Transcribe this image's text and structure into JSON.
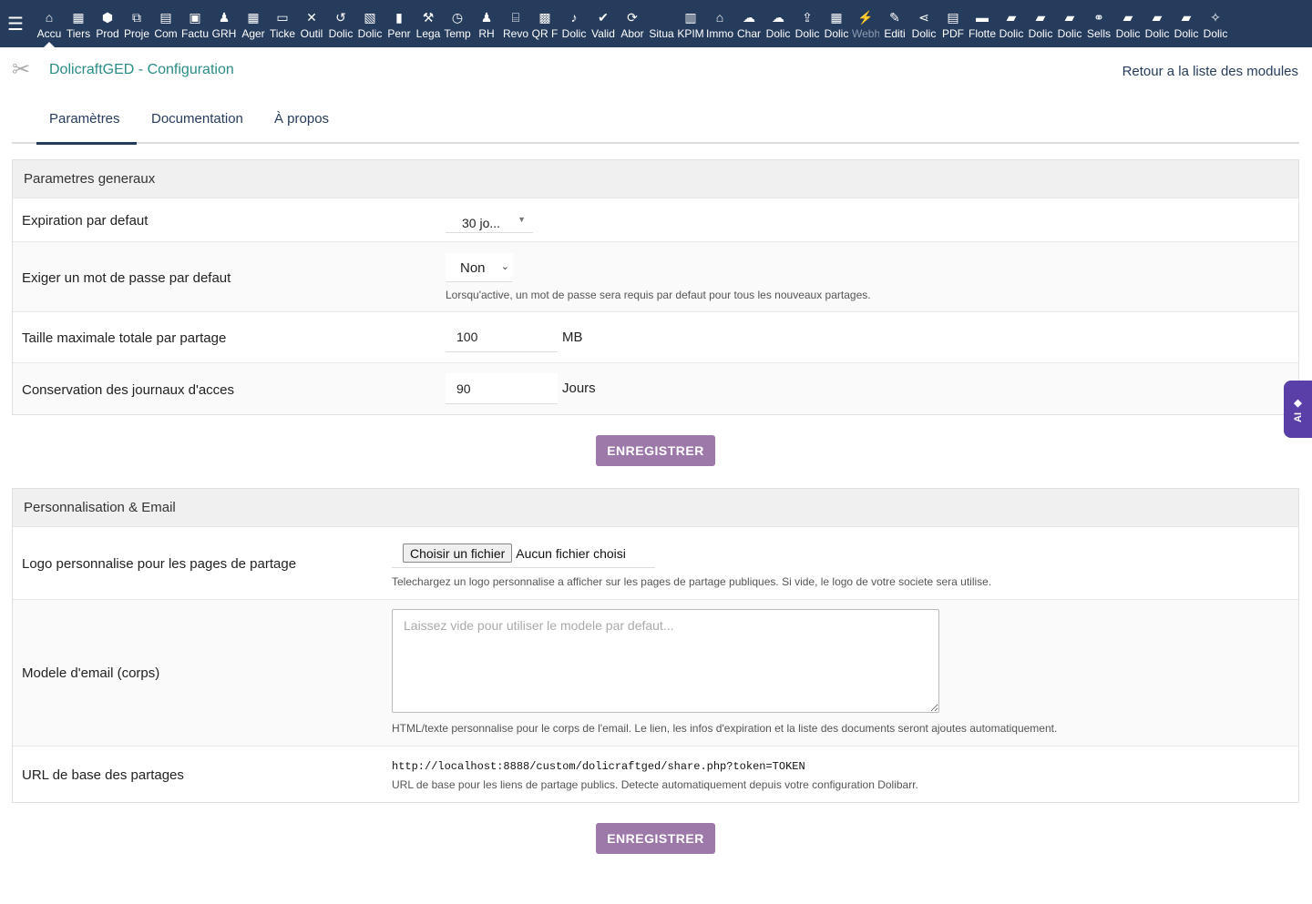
{
  "topbar": {
    "menu_icon": "hamburger-icon",
    "items": [
      {
        "label": "Accu",
        "icon": "home-icon",
        "glyph": "⌂",
        "active": true
      },
      {
        "label": "Tiers",
        "icon": "building-icon",
        "glyph": "▦"
      },
      {
        "label": "Prod",
        "icon": "cube-icon",
        "glyph": "⬢"
      },
      {
        "label": "Proje",
        "icon": "sitemap-icon",
        "glyph": "⧉"
      },
      {
        "label": "Com",
        "icon": "briefcase-icon",
        "glyph": "▤"
      },
      {
        "label": "Factu",
        "icon": "invoice-icon",
        "glyph": "▣"
      },
      {
        "label": "GRH",
        "icon": "user-tie-icon",
        "glyph": "♟"
      },
      {
        "label": "Ager",
        "icon": "calendar-icon",
        "glyph": "▦"
      },
      {
        "label": "Ticke",
        "icon": "ticket-icon",
        "glyph": "▭"
      },
      {
        "label": "Outil",
        "icon": "tools-icon",
        "glyph": "✕"
      },
      {
        "label": "Dolic",
        "icon": "undo-icon",
        "glyph": "↺"
      },
      {
        "label": "Dolic",
        "icon": "briefcase-file-icon",
        "glyph": "▧"
      },
      {
        "label": "Penr",
        "icon": "note-icon",
        "glyph": "▮"
      },
      {
        "label": "Lega",
        "icon": "gavel-icon",
        "glyph": "⚒"
      },
      {
        "label": "Temp",
        "icon": "clock-icon",
        "glyph": "◷"
      },
      {
        "label": "RH",
        "icon": "users-icon",
        "glyph": "♟"
      },
      {
        "label": "Revo",
        "icon": "bank-icon",
        "glyph": "⌸"
      },
      {
        "label": "QR F",
        "icon": "qrcode-icon",
        "glyph": "▩"
      },
      {
        "label": "Dolic",
        "icon": "bell-icon",
        "glyph": "♪"
      },
      {
        "label": "Valid",
        "icon": "check-double-icon",
        "glyph": "✔"
      },
      {
        "label": "Abor",
        "icon": "sync-icon",
        "glyph": "⟳"
      },
      {
        "label": "Situa",
        "icon": "blank-icon",
        "glyph": ""
      },
      {
        "label": "KPIM",
        "icon": "chart-bar-icon",
        "glyph": "▥"
      },
      {
        "label": "Immo",
        "icon": "house-icon",
        "glyph": "⌂"
      },
      {
        "label": "Char",
        "icon": "cloud-chart-icon",
        "glyph": "☁"
      },
      {
        "label": "Dolic",
        "icon": "cloud-icon",
        "glyph": "☁"
      },
      {
        "label": "Dolic",
        "icon": "upload-icon",
        "glyph": "⇪"
      },
      {
        "label": "Dolic",
        "icon": "office-icon",
        "glyph": "▦"
      },
      {
        "label": "Webh",
        "icon": "plug-icon",
        "glyph": "⚡",
        "dim": true
      },
      {
        "label": "Editi",
        "icon": "edit-icon",
        "glyph": "✎"
      },
      {
        "label": "Dolic",
        "icon": "share-icon",
        "glyph": "⋖"
      },
      {
        "label": "PDF",
        "icon": "pdf-icon",
        "glyph": "▤"
      },
      {
        "label": "Flotte",
        "icon": "car-icon",
        "glyph": "▬"
      },
      {
        "label": "Dolic",
        "icon": "note-page-icon",
        "glyph": "▰"
      },
      {
        "label": "Dolic",
        "icon": "note-page-icon",
        "glyph": "▰"
      },
      {
        "label": "Dolic",
        "icon": "note-page-icon",
        "glyph": "▰"
      },
      {
        "label": "Sells",
        "icon": "handshake-icon",
        "glyph": "⚭"
      },
      {
        "label": "Dolic",
        "icon": "note-page-icon",
        "glyph": "▰"
      },
      {
        "label": "Dolic",
        "icon": "note-page-icon",
        "glyph": "▰"
      },
      {
        "label": "Dolic",
        "icon": "note-page-icon",
        "glyph": "▰"
      },
      {
        "label": "Dolic",
        "icon": "magic-wand-icon",
        "glyph": "✧"
      }
    ]
  },
  "header": {
    "title": "DolicraftGED - Configuration",
    "back_link": "Retour a la liste des modules"
  },
  "tabs": [
    "Paramètres",
    "Documentation",
    "À propos"
  ],
  "general": {
    "heading": "Parametres generaux",
    "expiration": {
      "label": "Expiration par defaut",
      "value": "30 jo..."
    },
    "password": {
      "label": "Exiger un mot de passe par defaut",
      "value": "Non",
      "help": "Lorsqu'active, un mot de passe sera requis par defaut pour tous les nouveaux partages."
    },
    "max_size": {
      "label": "Taille maximale totale par partage",
      "value": "100",
      "unit": "MB"
    },
    "log_retention": {
      "label": "Conservation des journaux d'acces",
      "value": "90",
      "unit": "Jours"
    },
    "save_label": "ENREGISTRER"
  },
  "personalisation": {
    "heading": "Personnalisation & Email",
    "logo": {
      "label": "Logo personnalise pour les pages de partage",
      "button": "Choisir un fichier",
      "status": "Aucun fichier choisi",
      "help": "Telechargez un logo personnalise a afficher sur les pages de partage publiques. Si vide, le logo de votre societe sera utilise."
    },
    "email_template": {
      "label": "Modele d'email (corps)",
      "placeholder": "Laissez vide pour utiliser le modele par defaut...",
      "help": "HTML/texte personnalise pour le corps de l'email. Le lien, les infos d'expiration et la liste des documents seront ajoutes automatiquement."
    },
    "base_url": {
      "label": "URL de base des partages",
      "value": "http://localhost:8888/custom/dolicraftged/share.php?token=TOKEN",
      "help": "URL de base pour les liens de partage publics. Detecte automatiquement depuis votre configuration Dolibarr."
    },
    "save_label": "ENREGISTRER"
  },
  "ai_tab": {
    "label": "AI",
    "icon": "sparkle-icon"
  }
}
